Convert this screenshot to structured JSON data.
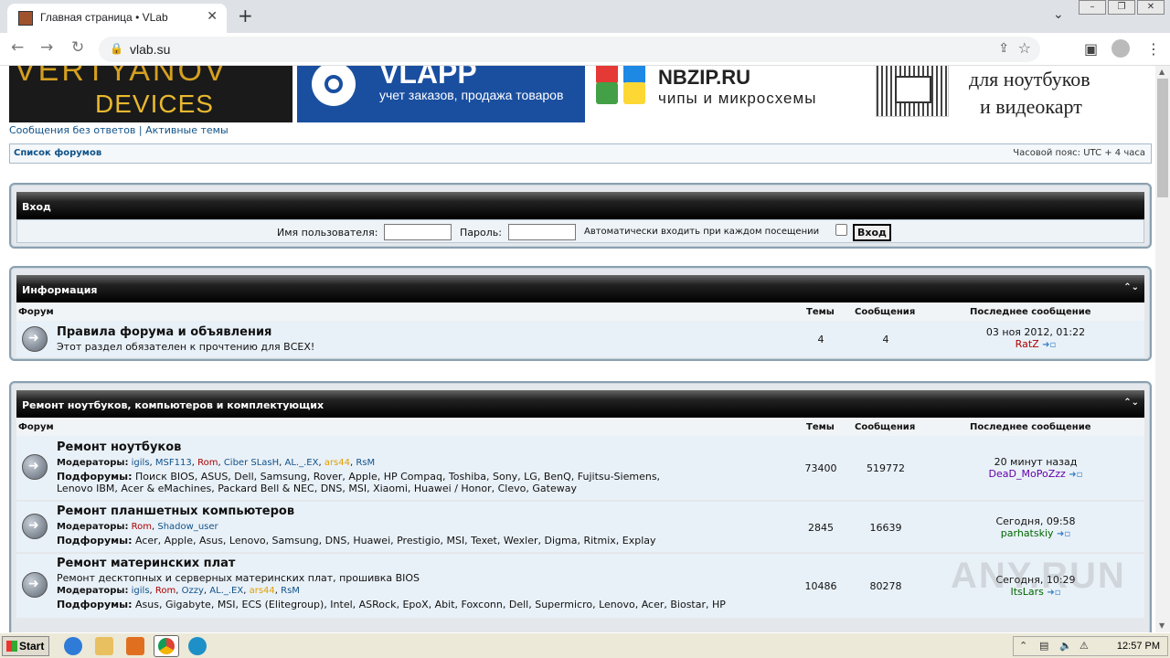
{
  "browser": {
    "tab_title": "Главная страница • VLab",
    "url": "vlab.su"
  },
  "banners": {
    "b1_line1": "VERTYANOV",
    "b1_line2": "DEVICES",
    "b2_title": "VLAPP",
    "b2_sub": "учет заказов, продажа товаров",
    "b3_title": "NBZIP.RU",
    "b3_sub": "чипы и микросхемы",
    "b4_line1": "для ноутбуков",
    "b4_line2": "и видеокарт"
  },
  "toplinks": {
    "unanswered": "Сообщения без ответов",
    "sep": "|",
    "active": "Активные темы"
  },
  "navbar": {
    "forum_list": "Список форумов",
    "timezone": "Часовой пояс: UTC + 4 часа"
  },
  "login": {
    "title": "Вход",
    "username_label": "Имя пользователя:",
    "password_label": "Пароль:",
    "autologin_label": "Автоматически входить при каждом посещении",
    "submit": "Вход"
  },
  "columns": {
    "forum": "Форум",
    "topics": "Темы",
    "posts": "Сообщения",
    "last_post": "Последнее сообщение"
  },
  "info_section": {
    "title": "Информация",
    "forum": {
      "name": "Правила форума и объявления",
      "desc": "Этот раздел обязателен к прочтению для ВСЕХ!",
      "topics": "4",
      "posts": "4",
      "last_time": "03 ноя 2012, 01:22",
      "last_user": "RatZ"
    }
  },
  "repair_section": {
    "title": "Ремонт ноутбуков, компьютеров и комплектующих",
    "mods_label": "Модераторы:",
    "sub_label": "Подфорумы:",
    "forums": [
      {
        "name": "Ремонт ноутбуков",
        "desc": "",
        "mods": [
          "igils",
          "MSF113",
          "Rom",
          "Ciber SLasH",
          "AL._.EX",
          "ars44",
          "RsM"
        ],
        "subforums": "Поиск BIOS, ASUS, Dell, Samsung, Rover, Apple, HP Compaq, Toshiba, Sony, LG, BenQ, Fujitsu-Siemens, Lenovo IBM, Acer & eMachines, Packard Bell & NEC, DNS, MSI, Xiaomi, Huawei / Honor, Clevo, Gateway",
        "topics": "73400",
        "posts": "519772",
        "last_time": "20 минут назад",
        "last_user": "DeaD_MoPoZzz"
      },
      {
        "name": "Ремонт планшетных компьютеров",
        "desc": "",
        "mods": [
          "Rom",
          "Shadow_user"
        ],
        "subforums": "Acer, Apple, Asus, Lenovo, Samsung, DNS, Huawei, Prestigio, MSI, Texet, Wexler, Digma, Ritmix, Explay",
        "topics": "2845",
        "posts": "16639",
        "last_time": "Сегодня, 09:58",
        "last_user": "parhatskiy"
      },
      {
        "name": "Ремонт материнских плат",
        "desc": "Ремонт десктопных и серверных материнских плат, прошивка BIOS",
        "mods": [
          "igils",
          "Rom",
          "Ozzy",
          "AL._.EX",
          "ars44",
          "RsM"
        ],
        "subforums": "Asus, Gigabyte, MSI, ECS (Elitegroup), Intel, ASRock, EpoX, Abit, Foxconn, Dell, Supermicro, Lenovo, Acer, Biostar, HP",
        "topics": "10486",
        "posts": "80278",
        "last_time": "Сегодня, 10:29",
        "last_user": "ItsLars"
      }
    ]
  },
  "taskbar": {
    "start": "Start",
    "clock": "12:57 PM"
  },
  "watermark": "ANY.RUN"
}
